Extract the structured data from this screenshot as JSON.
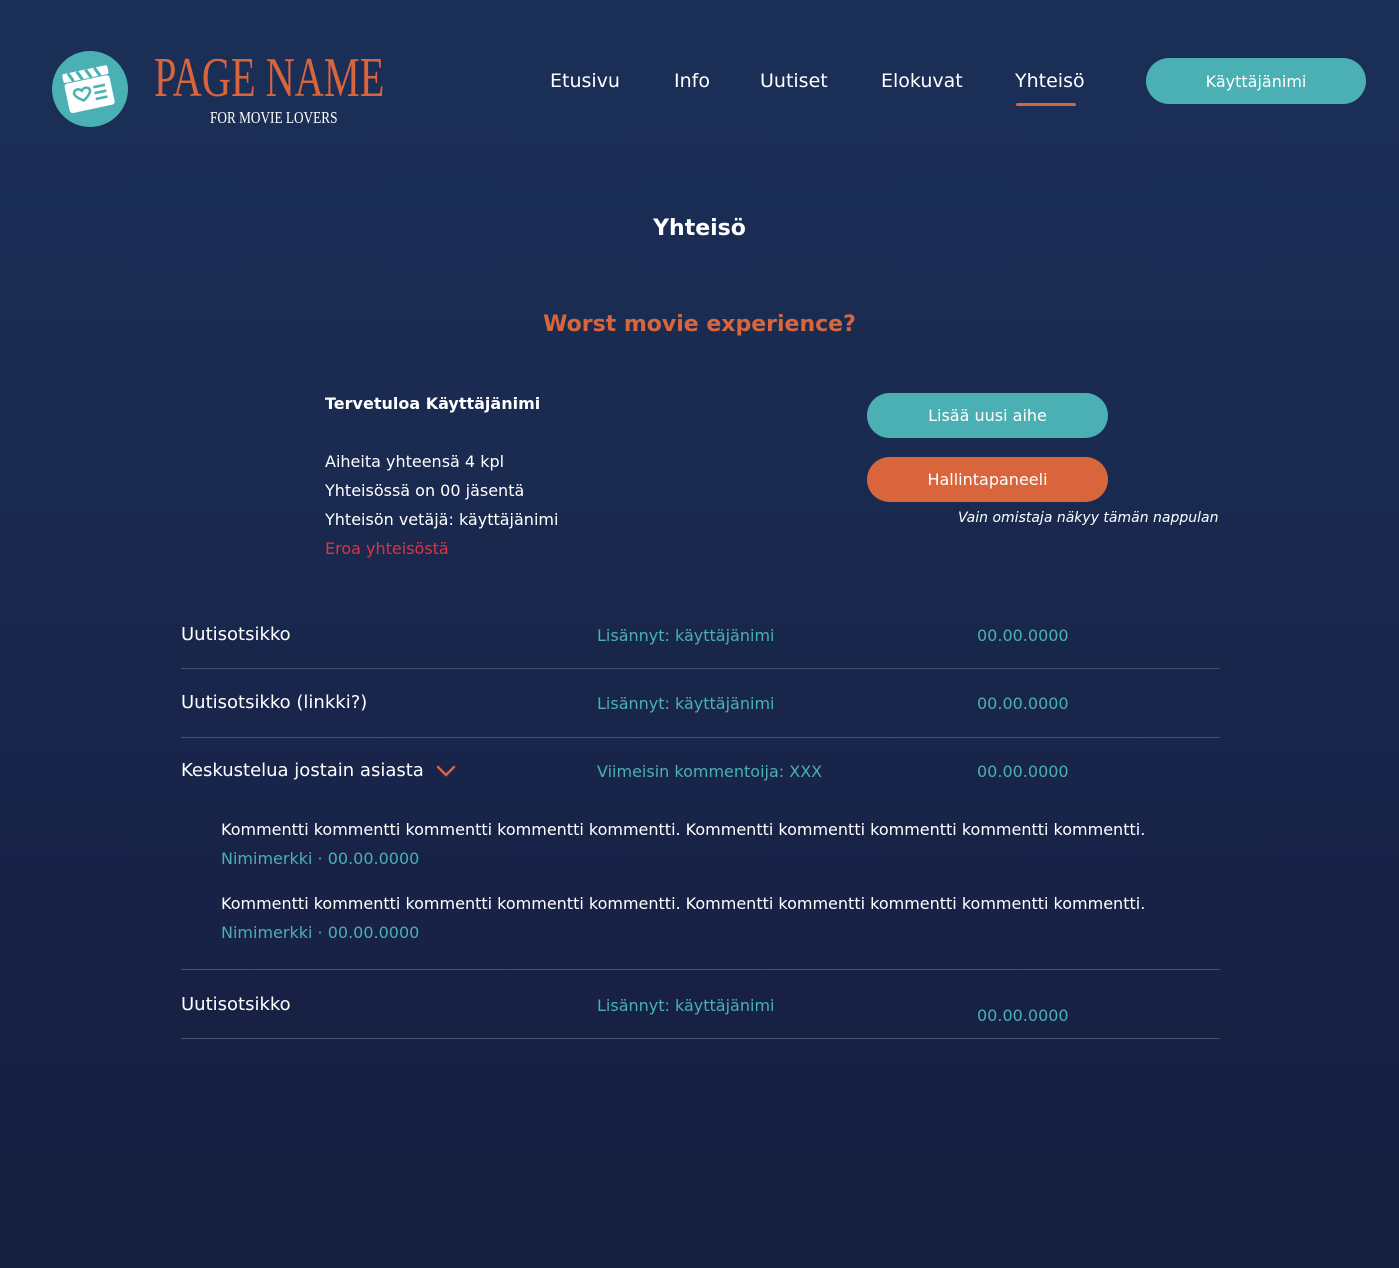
{
  "logo": {
    "title": "PAGE NAME",
    "subtitle": "FOR MOVIE LOVERS",
    "icon": "clapperboard-heart-icon"
  },
  "nav": {
    "items": [
      "Etusivu",
      "Info",
      "Uutiset",
      "Elokuvat",
      "Yhteisö"
    ],
    "active": "Yhteisö",
    "user_button": "Käyttäjänimi"
  },
  "page": {
    "title": "Yhteisö",
    "topic_title": "Worst movie experience?"
  },
  "community": {
    "welcome": "Tervetuloa Käyttäjänimi",
    "topics_count": "Aiheita yhteensä 4 kpl",
    "members": "Yhteisössä on 00 jäsentä",
    "leader": "Yhteisön vetäjä: käyttäjänimi",
    "leave": "Eroa yhteisöstä"
  },
  "actions": {
    "add_topic": "Lisää uusi aihe",
    "admin_panel": "Hallintapaneeli",
    "owner_note": "Vain omistaja näkyy tämän nappulan"
  },
  "rows": [
    {
      "title": "Uutisotsikko",
      "meta": "Lisännyt: käyttäjänimi",
      "date": "00.00.0000"
    },
    {
      "title": "Uutisotsikko (linkki?)",
      "meta": "Lisännyt: käyttäjänimi",
      "date": "00.00.0000"
    },
    {
      "title": "Keskustelua jostain asiasta",
      "meta": "Viimeisin kommentoija: XXX",
      "date": "00.00.0000"
    },
    {
      "title": "Uutisotsikko",
      "meta": "Lisännyt: käyttäjänimi",
      "date": "00.00.0000"
    }
  ],
  "comments": [
    {
      "text": "Kommentti kommentti kommentti kommentti kommentti. Kommentti kommentti kommentti kommentti kommentti.",
      "author": "Nimimerkki",
      "separator": "·",
      "date": "00.00.0000"
    },
    {
      "text": "Kommentti kommentti kommentti kommentti kommentti. Kommentti kommentti kommentti kommentti kommentti.",
      "author": "Nimimerkki",
      "separator": "·",
      "date": "00.00.0000"
    }
  ],
  "colors": {
    "accent_teal": "#4ab0b3",
    "accent_orange": "#d9653d",
    "danger_red": "#e0343f",
    "background": "#1a2a50"
  }
}
